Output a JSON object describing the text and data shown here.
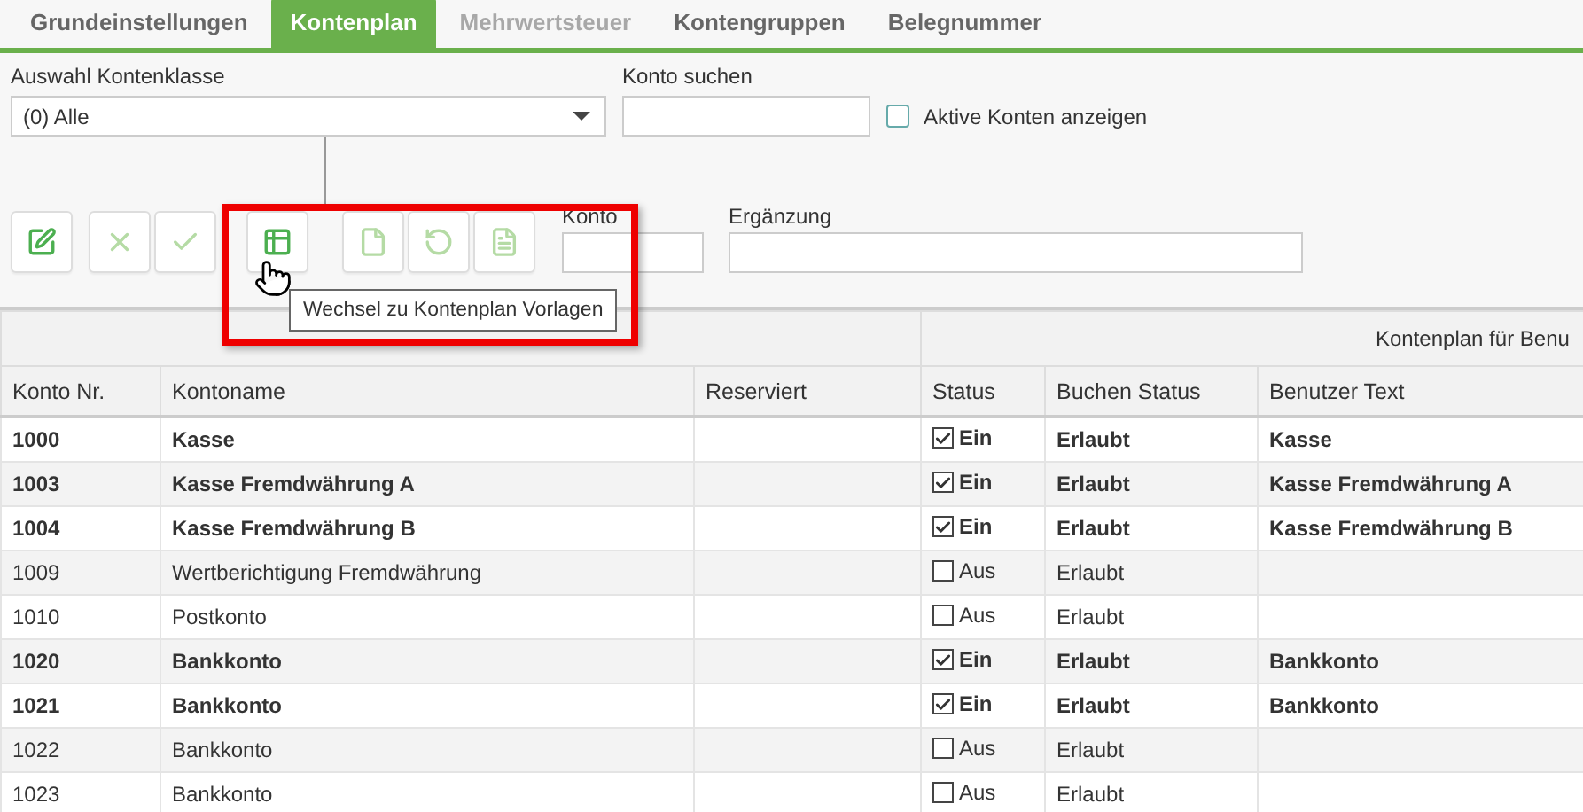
{
  "tabs": [
    {
      "label": "Grundeinstellungen",
      "selected": false,
      "disabled": false
    },
    {
      "label": "Kontenplan",
      "selected": true,
      "disabled": false
    },
    {
      "label": "Mehrwertsteuer",
      "selected": false,
      "disabled": true
    },
    {
      "label": "Kontengruppen",
      "selected": false,
      "disabled": false
    },
    {
      "label": "Belegnummer",
      "selected": false,
      "disabled": false
    }
  ],
  "filters": {
    "class_label": "Auswahl Kontenklasse",
    "class_value": "(0) Alle",
    "search_label": "Konto suchen",
    "active_only": {
      "label": "Aktive Konten anzeigen",
      "checked": false
    }
  },
  "toolbar": {
    "buttons": [
      {
        "kind": "edit",
        "disabled": false
      },
      {
        "kind": "cancel",
        "disabled": true
      },
      {
        "kind": "confirm",
        "disabled": true
      },
      {
        "kind": "template",
        "disabled": false
      },
      {
        "kind": "new",
        "disabled": true
      },
      {
        "kind": "undo",
        "disabled": true
      },
      {
        "kind": "copy",
        "disabled": true
      }
    ],
    "konto_label": "Konto",
    "ergaenzung_label": "Ergänzung"
  },
  "tooltip": "Wechsel zu Kontenplan Vorlagen",
  "table": {
    "group_right": "Kontenplan für Benu",
    "columns": [
      "Konto Nr.",
      "Kontoname",
      "Reserviert",
      "Status",
      "Buchen Status",
      "Benutzer Text"
    ],
    "rows": [
      {
        "konto": "1000",
        "name": "Kasse",
        "status": {
          "checked": true,
          "label": "Ein"
        },
        "buchen": "Erlaubt",
        "text": "Kasse"
      },
      {
        "konto": "1003",
        "name": "Kasse Fremdwährung A",
        "status": {
          "checked": true,
          "label": "Ein"
        },
        "buchen": "Erlaubt",
        "text": "Kasse Fremdwährung A"
      },
      {
        "konto": "1004",
        "name": "Kasse Fremdwährung B",
        "status": {
          "checked": true,
          "label": "Ein"
        },
        "buchen": "Erlaubt",
        "text": "Kasse Fremdwährung B"
      },
      {
        "konto": "1009",
        "name": "Wertberichtigung Fremdwährung",
        "status": {
          "checked": false,
          "label": "Aus"
        },
        "buchen": "Erlaubt"
      },
      {
        "konto": "1010",
        "name": "Postkonto",
        "status": {
          "checked": false,
          "label": "Aus"
        },
        "buchen": "Erlaubt"
      },
      {
        "konto": "1020",
        "name": "Bankkonto",
        "status": {
          "checked": true,
          "label": "Ein"
        },
        "buchen": "Erlaubt",
        "text": "Bankkonto"
      },
      {
        "konto": "1021",
        "name": "Bankkonto",
        "status": {
          "checked": true,
          "label": "Ein"
        },
        "buchen": "Erlaubt",
        "text": "Bankkonto"
      },
      {
        "konto": "1022",
        "name": "Bankkonto",
        "status": {
          "checked": false,
          "label": "Aus"
        },
        "buchen": "Erlaubt"
      },
      {
        "konto": "1023",
        "name": "Bankkonto",
        "status": {
          "checked": false,
          "label": "Aus"
        },
        "buchen": "Erlaubt"
      }
    ]
  }
}
